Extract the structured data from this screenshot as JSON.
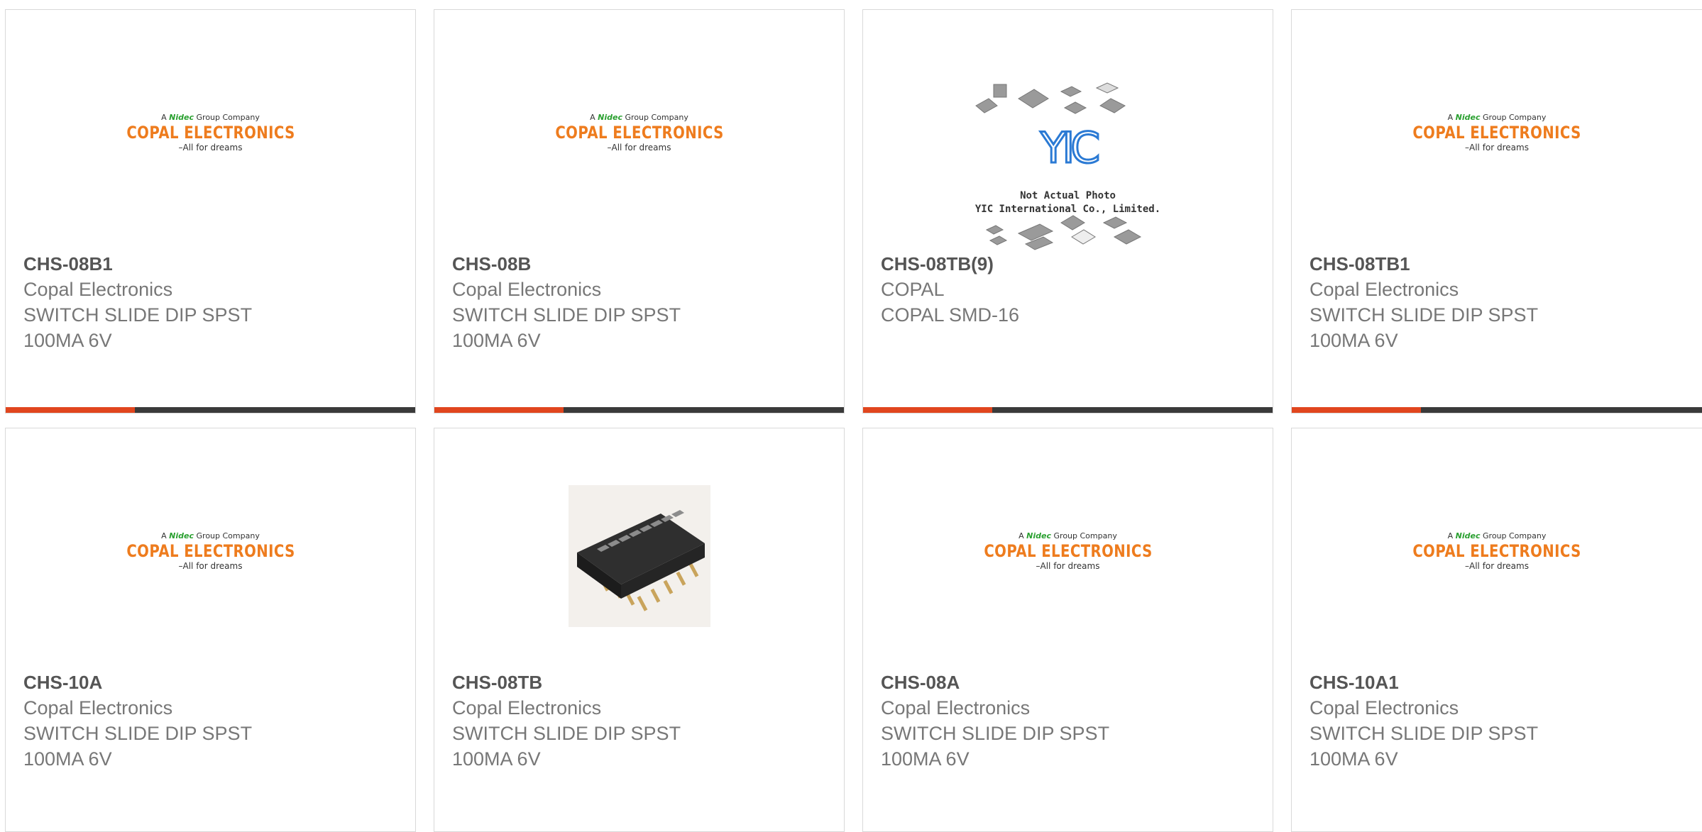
{
  "products": [
    {
      "part": "CHS-08B1",
      "maker": "Copal Electronics",
      "desc1": "SWITCH SLIDE DIP SPST",
      "desc2": "100MA 6V",
      "image": "copal-logo"
    },
    {
      "part": "CHS-08B",
      "maker": "Copal Electronics",
      "desc1": "SWITCH SLIDE DIP SPST",
      "desc2": "100MA 6V",
      "image": "copal-logo"
    },
    {
      "part": "CHS-08TB(9)",
      "maker": "COPAL",
      "desc1": "COPAL SMD-16",
      "desc2": "",
      "image": "yic-placeholder"
    },
    {
      "part": "CHS-08TB1",
      "maker": "Copal Electronics",
      "desc1": "SWITCH SLIDE DIP SPST",
      "desc2": "100MA 6V",
      "image": "copal-logo"
    },
    {
      "part": "CHS-10A",
      "maker": "Copal Electronics",
      "desc1": "SWITCH SLIDE DIP SPST",
      "desc2": "100MA 6V",
      "image": "copal-logo"
    },
    {
      "part": "CHS-08TB",
      "maker": "Copal Electronics",
      "desc1": "SWITCH SLIDE DIP SPST",
      "desc2": "100MA 6V",
      "image": "dip-switch-photo"
    },
    {
      "part": "CHS-08A",
      "maker": "Copal Electronics",
      "desc1": "SWITCH SLIDE DIP SPST",
      "desc2": "100MA 6V",
      "image": "copal-logo"
    },
    {
      "part": "CHS-10A1",
      "maker": "Copal Electronics",
      "desc1": "SWITCH SLIDE DIP SPST",
      "desc2": "100MA 6V",
      "image": "copal-logo"
    }
  ],
  "logo": {
    "top_prefix": "A",
    "top_brand": "Nidec",
    "top_suffix": "Group Company",
    "main": "COPAL ELECTRONICS",
    "tagline": "–All for dreams"
  },
  "yic": {
    "mark": "YIC",
    "line1": "Not Actual Photo",
    "line2": "YIC International Co., Limited."
  },
  "colors": {
    "accent": "#e1461e",
    "bar": "#3a3a3a",
    "logo_orange": "#ee7c1e",
    "nidec_green": "#2aa030"
  }
}
